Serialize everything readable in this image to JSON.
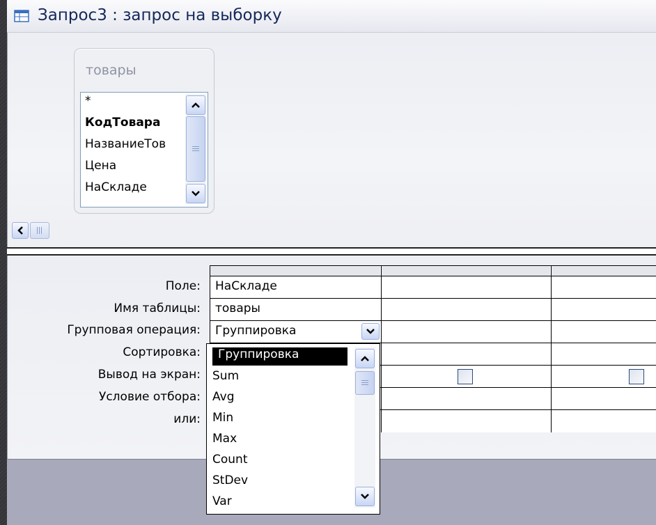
{
  "window": {
    "title": "Запрос3 : запрос на выборку",
    "icon": "query-icon"
  },
  "table_box": {
    "name": "товары",
    "fields": [
      "*",
      "КодТовара",
      "НазваниеТов",
      "Цена",
      "НаСкладе"
    ]
  },
  "grid": {
    "row_labels": [
      "Поле:",
      "Имя таблицы:",
      "Групповая операция:",
      "Сортировка:",
      "Вывод на экран:",
      "Условие отбора:",
      "или:"
    ],
    "column1": {
      "field": "НаСкладе",
      "table": "товары",
      "group_op": "Группировка"
    }
  },
  "dropdown": {
    "selected": "Группировка",
    "options": [
      "Sum",
      "Avg",
      "Min",
      "Max",
      "Count",
      "StDev",
      "Var"
    ]
  },
  "colors": {
    "selection": "#000000",
    "accent": "#15285a"
  }
}
